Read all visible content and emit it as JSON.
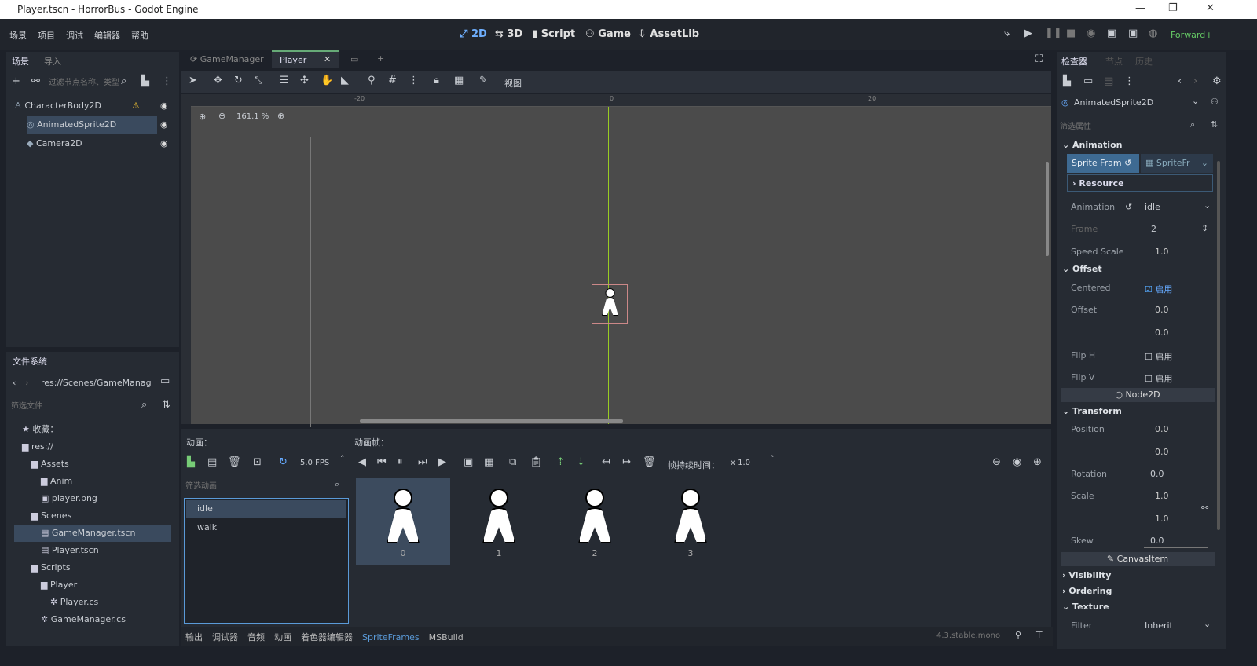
{
  "window": {
    "title": "Player.tscn - HorrorBus - Godot Engine",
    "min": "—",
    "max": "❐",
    "close": "✕"
  },
  "menu": [
    "场景",
    "项目",
    "调试",
    "编辑器",
    "帮助"
  ],
  "modes": [
    {
      "icon": "2d-icon",
      "label": "2D"
    },
    {
      "icon": "3d-icon",
      "label": "3D"
    },
    {
      "icon": "script-icon",
      "label": "Script"
    },
    {
      "icon": "game-icon",
      "label": "Game"
    },
    {
      "icon": "assetlib-icon",
      "label": "AssetLib"
    }
  ],
  "renderer": "Forward+",
  "scene_dock": {
    "tabs": [
      "场景",
      "导入"
    ],
    "filter_placeholder": "过滤节点名称、类型",
    "nodes": [
      {
        "name": "CharacterBody2D",
        "warning": "⚠"
      },
      {
        "name": "AnimatedSprite2D"
      },
      {
        "name": "Camera2D"
      }
    ]
  },
  "editor_tabs": [
    {
      "label": "GameManager"
    },
    {
      "label": "Player",
      "close": "✕"
    }
  ],
  "toolbar": {
    "view": "视图"
  },
  "viewport": {
    "zoom": "161.1 %",
    "ruler": [
      "-20",
      "0",
      "20"
    ]
  },
  "filesystem": {
    "title": "文件系统",
    "path": "res://Scenes/GameManag",
    "filter_placeholder": "筛选文件",
    "items": [
      {
        "label": "收藏：",
        "indent": 0,
        "icon": "★"
      },
      {
        "label": "res://",
        "indent": 0,
        "icon": "▆"
      },
      {
        "label": "Assets",
        "indent": 1,
        "icon": "▆"
      },
      {
        "label": "Anim",
        "indent": 2,
        "icon": "▆"
      },
      {
        "label": "player.png",
        "indent": 2,
        "icon": "▣"
      },
      {
        "label": "Scenes",
        "indent": 1,
        "icon": "▆"
      },
      {
        "label": "GameManager.tscn",
        "indent": 2,
        "icon": "▤",
        "selected": true
      },
      {
        "label": "Player.tscn",
        "indent": 2,
        "icon": "▤"
      },
      {
        "label": "Scripts",
        "indent": 1,
        "icon": "▆"
      },
      {
        "label": "Player",
        "indent": 2,
        "icon": "▆"
      },
      {
        "label": "Player.cs",
        "indent": 3,
        "icon": "✲"
      },
      {
        "label": "GameManager.cs",
        "indent": 2,
        "icon": "✲"
      }
    ]
  },
  "spriteframes": {
    "anim_label": "动画：",
    "frames_label": "动画帧：",
    "fps": "5.0 FPS",
    "filter_placeholder": "筛选动画",
    "frame_duration_label": "帧持续时间：",
    "frame_duration": "x 1.0",
    "animations": [
      "idle",
      "walk"
    ],
    "frames": [
      "0",
      "1",
      "2",
      "3"
    ]
  },
  "bottom_tabs": [
    "输出",
    "调试器",
    "音频",
    "动画",
    "着色器编辑器",
    "SpriteFrames",
    "MSBuild"
  ],
  "version": "4.3.stable.mono",
  "inspector": {
    "tabs": [
      "检查器",
      "节点",
      "历史"
    ],
    "node": "AnimatedSprite2D",
    "filter_placeholder": "筛选属性",
    "animation_section": "Animation",
    "sprite_frames_label": "Sprite Fram",
    "sprite_frames_value": "SpriteFr",
    "resource": "Resource",
    "animation_label": "Animation",
    "animation_value": "idle",
    "frame_label": "Frame",
    "frame_value": "2",
    "speed_label": "Speed Scale",
    "speed_value": "1.0",
    "offset_section": "Offset",
    "centered_label": "Centered",
    "enabled": "启用",
    "offset_label": "Offset",
    "offset_x": "0.0",
    "offset_y": "0.0",
    "fliph_label": "Flip H",
    "flipv_label": "Flip V",
    "node2d": "Node2D",
    "transform": "Transform",
    "position_label": "Position",
    "pos_x": "0.0",
    "pos_y": "0.0",
    "rotation_label": "Rotation",
    "rotation": "0.0",
    "scale_label": "Scale",
    "scale_x": "1.0",
    "scale_y": "1.0",
    "skew_label": "Skew",
    "skew": "0.0",
    "canvasitem": "CanvasItem",
    "visibility": "Visibility",
    "ordering": "Ordering",
    "texture": "Texture",
    "filter_label": "Filter",
    "filter_value": "Inherit"
  }
}
